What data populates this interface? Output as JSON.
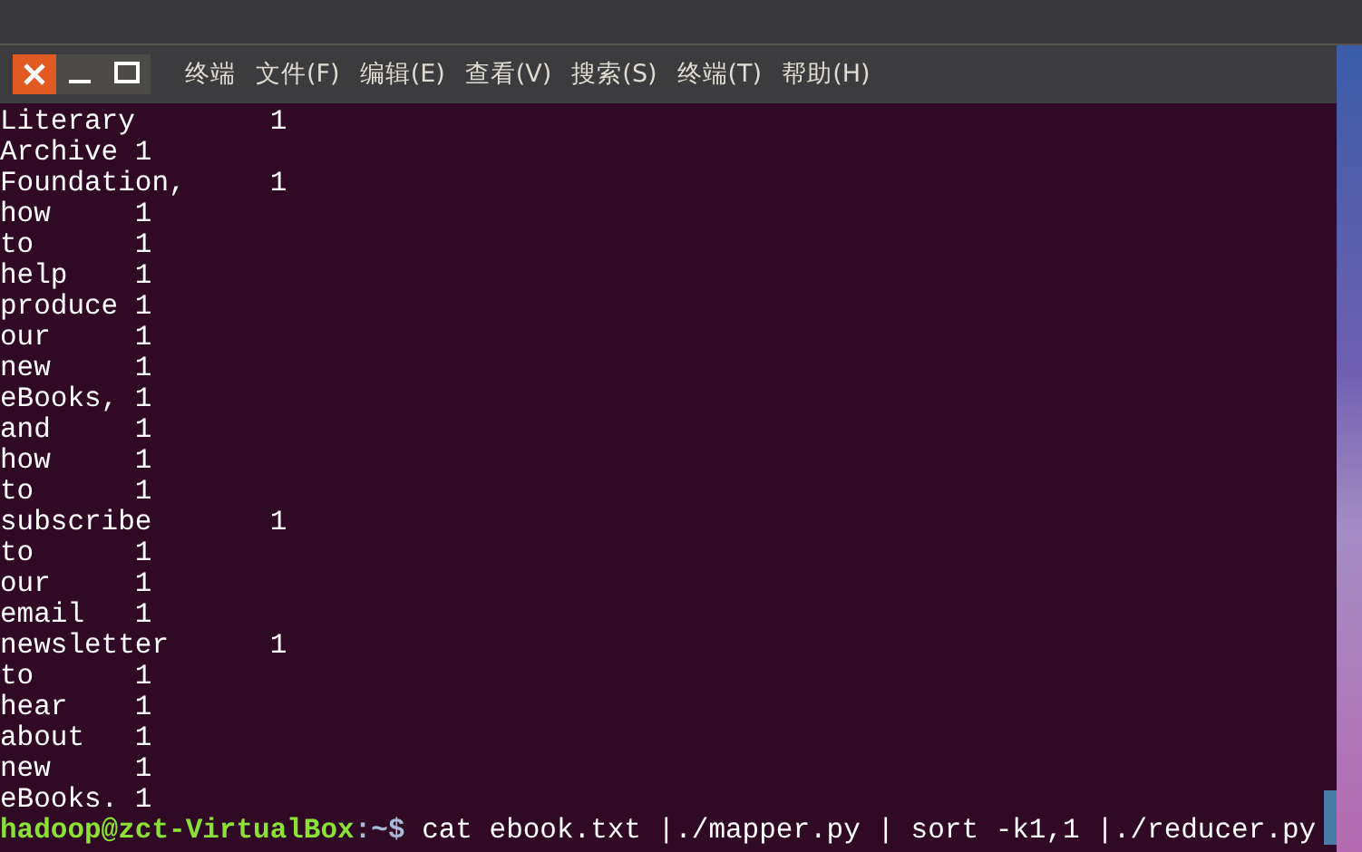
{
  "window": {
    "app_name": "终端",
    "menus": [
      "文件(F)",
      "编辑(E)",
      "查看(V)",
      "搜索(S)",
      "终端(T)",
      "帮助(H)"
    ]
  },
  "output": [
    {
      "word": "Literary",
      "count": "1"
    },
    {
      "word": "Archive",
      "count": "1"
    },
    {
      "word": "Foundation,",
      "count": "1"
    },
    {
      "word": "how",
      "count": "1"
    },
    {
      "word": "to",
      "count": "1"
    },
    {
      "word": "help",
      "count": "1"
    },
    {
      "word": "produce",
      "count": "1"
    },
    {
      "word": "our",
      "count": "1"
    },
    {
      "word": "new",
      "count": "1"
    },
    {
      "word": "eBooks,",
      "count": "1"
    },
    {
      "word": "and",
      "count": "1"
    },
    {
      "word": "how",
      "count": "1"
    },
    {
      "word": "to",
      "count": "1"
    },
    {
      "word": "subscribe",
      "count": "1"
    },
    {
      "word": "to",
      "count": "1"
    },
    {
      "word": "our",
      "count": "1"
    },
    {
      "word": "email",
      "count": "1"
    },
    {
      "word": "newsletter",
      "count": "1"
    },
    {
      "word": "to",
      "count": "1"
    },
    {
      "word": "hear",
      "count": "1"
    },
    {
      "word": "about",
      "count": "1"
    },
    {
      "word": "new",
      "count": "1"
    },
    {
      "word": "eBooks.",
      "count": "1"
    }
  ],
  "prompt": {
    "user_host": "hadoop@zct-VirtualBox",
    "location": ":~$",
    "command": "cat ebook.txt |./mapper.py | sort -k1,1 |./reducer.py"
  }
}
